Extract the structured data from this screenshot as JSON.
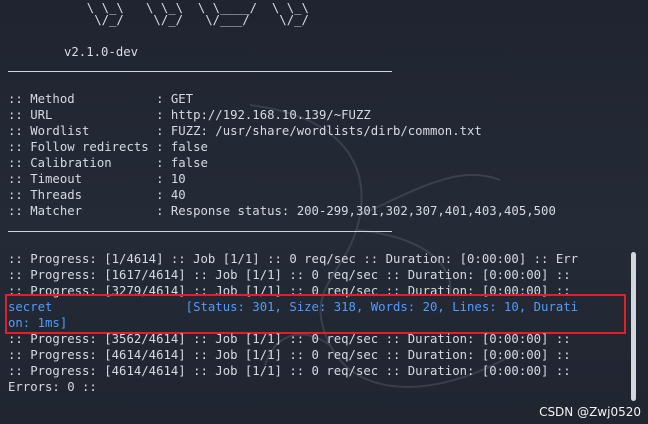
{
  "banner": {
    "art_line_1": "  \\ \\_\\   \\ \\_\\  \\ \\____/  \\ \\_\\",
    "art_line_2": "   \\/_/    \\/_/   \\/___/    \\/_/",
    "version": "v2.1.0-dev"
  },
  "settings": [
    ":: Method           : GET",
    ":: URL              : http://192.168.10.139/~FUZZ",
    ":: Wordlist         : FUZZ: /usr/share/wordlists/dirb/common.txt",
    ":: Follow redirects : false",
    ":: Calibration      : false",
    ":: Timeout          : 10",
    ":: Threads          : 40",
    ":: Matcher          : Response status: 200-299,301,302,307,401,403,405,500"
  ],
  "output": [
    ":: Progress: [1/4614] :: Job [1/1] :: 0 req/sec :: Duration: [0:00:00] :: Err",
    ":: Progress: [1617/4614] :: Job [1/1] :: 0 req/sec :: Duration: [0:00:00] ::",
    ":: Progress: [3279/4614] :: Job [1/1] :: 0 req/sec :: Duration: [0:00:00] ::"
  ],
  "match": {
    "line1": "secret                  [Status: 301, Size: 318, Words: 20, Lines: 10, Durati",
    "line2": "on: 1ms]"
  },
  "output_after": [
    ":: Progress: [3562/4614] :: Job [1/1] :: 0 req/sec :: Duration: [0:00:00] ::",
    ":: Progress: [4614/4614] :: Job [1/1] :: 0 req/sec :: Duration: [0:00:00] ::",
    ":: Progress: [4614/4614] :: Job [1/1] :: 0 req/sec :: Duration: [0:00:00] ::",
    "Errors: 0 ::"
  ],
  "watermark": "CSDN @Zwj0520",
  "colors": {
    "background": "#20242f",
    "text": "#d6dae2",
    "match_text": "#4f9cff",
    "highlight_border": "#e21f26"
  },
  "icons": {
    "background_logo": "kali-dragon-icon"
  }
}
